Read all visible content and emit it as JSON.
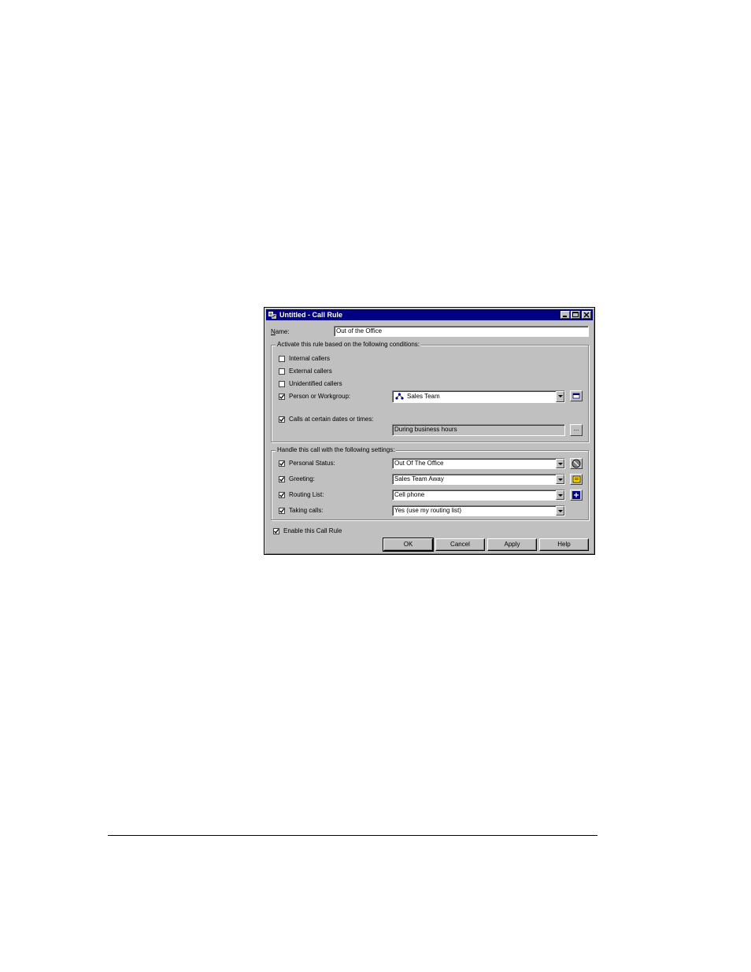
{
  "window": {
    "title": "Untitled - Call Rule",
    "controls": [
      "minimize",
      "maximize",
      "close"
    ]
  },
  "name_field": {
    "label": "Name:",
    "value": "Out of the Office"
  },
  "conditions": {
    "legend": "Activate this rule based on the following conditions:",
    "internal": {
      "label": "Internal callers",
      "checked": false
    },
    "external": {
      "label": "External callers",
      "checked": false
    },
    "unidentified": {
      "label": "Unidentified callers",
      "checked": false
    },
    "person": {
      "label": "Person or Workgroup:",
      "checked": true,
      "value": "Sales Team",
      "icon": "workgroup-icon"
    },
    "dates": {
      "label": "Calls at certain dates or times:",
      "checked": true,
      "value": "During business hours",
      "button_label": "..."
    }
  },
  "settings": {
    "legend": "Handle this call with the following settings:",
    "personal_status": {
      "label": "Personal Status:",
      "checked": true,
      "value": "Out Of The Office",
      "icon": "status-icon"
    },
    "greeting": {
      "label": "Greeting:",
      "checked": true,
      "value": "Sales Team Away",
      "icon": "greeting-icon"
    },
    "routing_list": {
      "label": "Routing List:",
      "checked": true,
      "value": "Cell phone",
      "icon": "routing-icon"
    },
    "taking_calls": {
      "label": "Taking calls:",
      "checked": true,
      "value": "Yes (use my routing list)"
    }
  },
  "enable": {
    "label": "Enable this Call Rule",
    "checked": true
  },
  "buttons": {
    "ok": "OK",
    "cancel": "Cancel",
    "apply": "Apply",
    "help": "Help"
  },
  "colors": {
    "titlebar": "#000080",
    "face": "#c0c0c0"
  }
}
